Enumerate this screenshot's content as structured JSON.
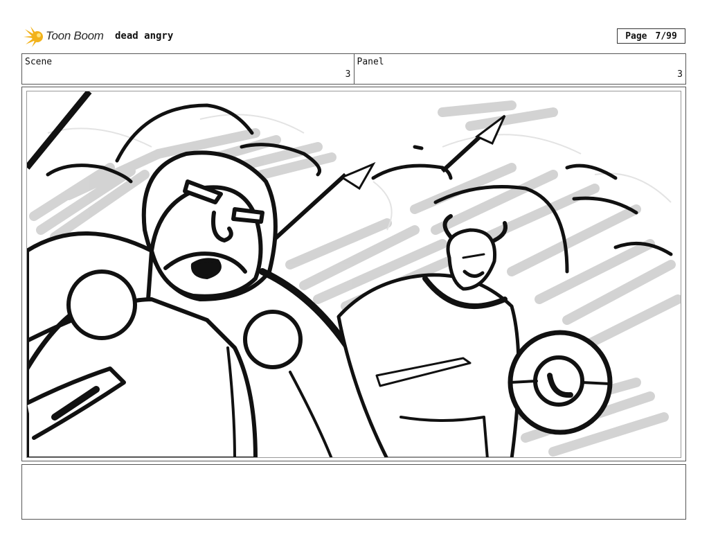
{
  "header": {
    "brand_name": "Toon Boom",
    "project_title": "dead angry",
    "page_label": "Page",
    "page_value": "7/99"
  },
  "info": {
    "scene_label": "Scene",
    "scene_value": "3",
    "panel_label": "Panel",
    "panel_value": "3"
  },
  "panel": {
    "image_name": "storyboard-sketch-viking-battle"
  },
  "notes": {
    "text": ""
  },
  "colors": {
    "logo_accent": "#f2b21a",
    "border": "#555555",
    "ink": "#111111",
    "shade": "#cfcfcf"
  }
}
